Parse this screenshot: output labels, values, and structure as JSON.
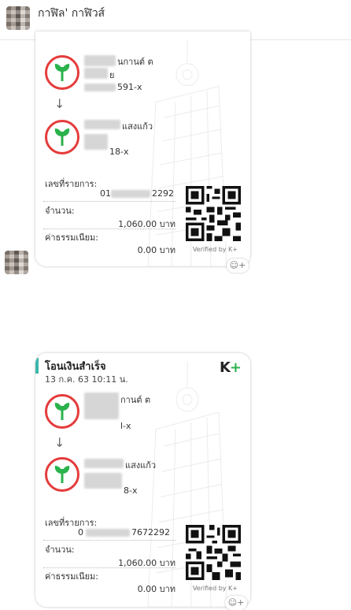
{
  "header": {
    "sender_name": "กาฬิล' กาฬิวส์"
  },
  "slips": [
    {
      "sender_name_suffix": "นกานต์ ต",
      "sender_line2_suffix": "ย",
      "sender_account_suffix": "591-x",
      "receiver_name_suffix": "แสงแก้ว",
      "receiver_account_suffix": "18-x",
      "ref_label": "เลขที่รายการ:",
      "ref_prefix": "01",
      "ref_suffix": "2292",
      "amount_label": "จำนวน:",
      "amount_value": "1,060.00 บาท",
      "fee_label": "ค่าธรรมเนียม:",
      "fee_value": "0.00 บาท",
      "verified": "Verified by K+"
    },
    {
      "title": "โอนเงินสำเร็จ",
      "date": "13 ก.ค. 63  10:11 น.",
      "brand": "K",
      "brand_plus": "+",
      "sender_name_suffix": "กานต์ ต",
      "sender_account_suffix": "l-x",
      "receiver_name_suffix": "แสงแก้ว",
      "receiver_account_suffix": "8-x",
      "ref_label": "เลขที่รายการ:",
      "ref_prefix": "0",
      "ref_suffix": "7672292",
      "amount_label": "จำนวน:",
      "amount_value": "1,060.00 บาท",
      "fee_label": "ค่าธรรมเนียม:",
      "fee_value": "0.00 บาท",
      "verified": "Verified by K+"
    }
  ],
  "icons": {
    "arrow": "↓",
    "reaction": "☺+"
  },
  "colors": {
    "bank_red": "#e53b3b",
    "bank_green": "#2bb24c",
    "accent_teal": "#3bb6ad"
  }
}
